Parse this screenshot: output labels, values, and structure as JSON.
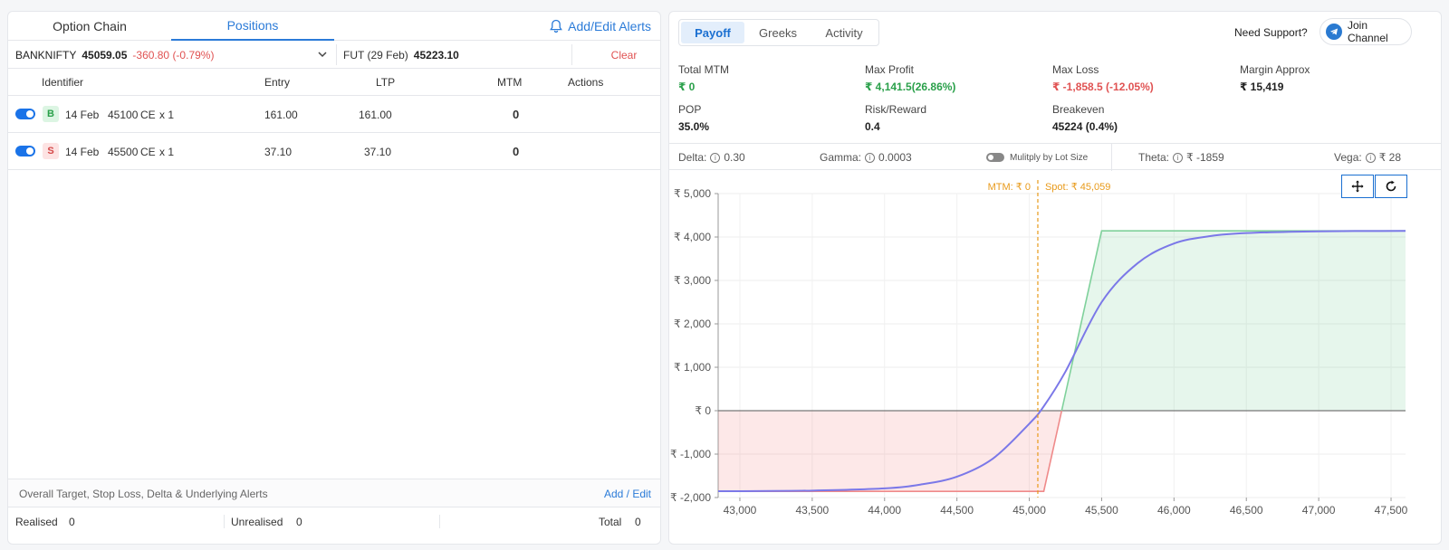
{
  "left": {
    "tabs": [
      {
        "label": "Option Chain"
      },
      {
        "label": "Positions"
      }
    ],
    "alerts_label": "Add/Edit Alerts",
    "underlying": {
      "name": "BANKNIFTY",
      "price": "45059.05",
      "change": "-360.80 (-0.79%)"
    },
    "future": {
      "label": "FUT (29 Feb)",
      "price": "45223.10"
    },
    "clear_label": "Clear",
    "columns": {
      "identifier": "Identifier",
      "entry": "Entry",
      "ltp": "LTP",
      "mtm": "MTM",
      "actions": "Actions"
    },
    "positions": [
      {
        "side": "B",
        "expiry": "14 Feb",
        "strike": "45100",
        "type": "CE",
        "qty": "x 1",
        "entry": "161.00",
        "ltp": "161.00",
        "mtm": "0"
      },
      {
        "side": "S",
        "expiry": "14 Feb",
        "strike": "45500",
        "type": "CE",
        "qty": "x 1",
        "entry": "37.10",
        "ltp": "37.10",
        "mtm": "0"
      }
    ],
    "alerts_bar": {
      "label": "Overall Target, Stop Loss, Delta & Underlying Alerts",
      "link": "Add / Edit"
    },
    "summary": {
      "realised_label": "Realised",
      "realised": "0",
      "unrealised_label": "Unrealised",
      "unrealised": "0",
      "total_label": "Total",
      "total": "0"
    }
  },
  "right": {
    "tabs": [
      {
        "label": "Payoff"
      },
      {
        "label": "Greeks"
      },
      {
        "label": "Activity"
      }
    ],
    "support_label": "Need Support?",
    "join_label": "Join Channel",
    "stats": {
      "total_mtm": {
        "label": "Total MTM",
        "value": "₹ 0"
      },
      "max_profit": {
        "label": "Max Profit",
        "value": "₹ 4,141.5(26.86%)"
      },
      "max_loss": {
        "label": "Max Loss",
        "value": "₹ -1,858.5 (-12.05%)"
      },
      "margin": {
        "label": "Margin Approx",
        "value": "₹ 15,419"
      },
      "pop": {
        "label": "POP",
        "value": "35.0%"
      },
      "risk_reward": {
        "label": "Risk/Reward",
        "value": "0.4"
      },
      "breakeven": {
        "label": "Breakeven",
        "value": "45224 (0.4%)"
      }
    },
    "greeks": {
      "delta_label": "Delta:",
      "delta": "0.30",
      "gamma_label": "Gamma:",
      "gamma": "0.0003",
      "multiply_label": "Mulitply by Lot Size",
      "theta_label": "Theta:",
      "theta": "₹ -1859",
      "vega_label": "Vega:",
      "vega": "₹ 28"
    }
  },
  "colors": {
    "accent": "#2b7bd8",
    "profit": "#2aa04a",
    "loss": "#e05252",
    "curve": "#7b78e8",
    "spot": "#e89a1a"
  },
  "chart_data": {
    "type": "area",
    "x_ticks": [
      "43,000",
      "43,500",
      "44,000",
      "44,500",
      "45,000",
      "45,500",
      "46,000",
      "46,500",
      "47,000",
      "47,500"
    ],
    "x_tick_values": [
      43000,
      43500,
      44000,
      44500,
      45000,
      45500,
      46000,
      46500,
      47000,
      47500
    ],
    "y_ticks": [
      "₹ 5,000",
      "₹ 4,000",
      "₹ 3,000",
      "₹ 2,000",
      "₹ 1,000",
      "₹ 0",
      "₹ -1,000",
      "₹ -2,000"
    ],
    "y_tick_values": [
      5000,
      4000,
      3000,
      2000,
      1000,
      0,
      -1000,
      -2000
    ],
    "xlim": [
      42850,
      47600
    ],
    "ylim": [
      -2000,
      5000
    ],
    "expiry_payoff": {
      "x": [
        42850,
        45100,
        45500,
        47600
      ],
      "y": [
        -1858.5,
        -1858.5,
        4141.5,
        4141.5
      ]
    },
    "mtm_curve": {
      "x": [
        42850,
        43000,
        43500,
        44000,
        44250,
        44500,
        44750,
        45000,
        45100,
        45250,
        45500,
        45750,
        46000,
        46250,
        46500,
        47000,
        47600
      ],
      "y": [
        -1855,
        -1853,
        -1840,
        -1790,
        -1700,
        -1520,
        -1100,
        -300,
        100,
        900,
        2500,
        3400,
        3850,
        4020,
        4090,
        4130,
        4141
      ]
    },
    "spot": 45059,
    "spot_label": "Spot: ₹ 45,059",
    "mtm_label": "MTM: ₹ 0"
  }
}
